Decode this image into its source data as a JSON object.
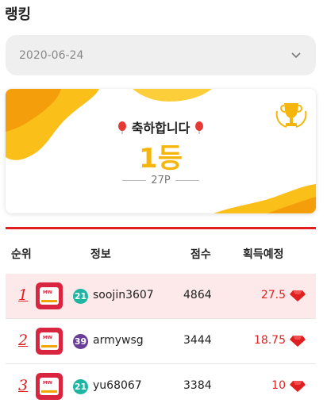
{
  "header": {
    "title": "랭킹"
  },
  "date_select": {
    "value": "2020-06-24"
  },
  "result_card": {
    "headline": "축하합니다",
    "rank": "1등",
    "points": "27P"
  },
  "table": {
    "columns": [
      "순위",
      "정보",
      "점수",
      "획득예정"
    ],
    "rows": [
      {
        "rank": "1",
        "level": "21",
        "level_color": "#1fb5a3",
        "name": "soojin3607",
        "score": "4864",
        "reward": "27.5"
      },
      {
        "rank": "2",
        "level": "39",
        "level_color": "#6a3d99",
        "name": "armywsg",
        "score": "3444",
        "reward": "18.75"
      },
      {
        "rank": "3",
        "level": "21",
        "level_color": "#1fb5a3",
        "name": "yu68067",
        "score": "3384",
        "reward": "10"
      }
    ]
  },
  "colors": {
    "accent": "#e02020",
    "gold": "#f5b50a",
    "highlight_row": "#fde8ea"
  },
  "icons": {
    "select": "chevron-down-icon",
    "balloon": "balloon-icon",
    "trophy": "trophy-icon",
    "gem": "ruby-icon"
  }
}
